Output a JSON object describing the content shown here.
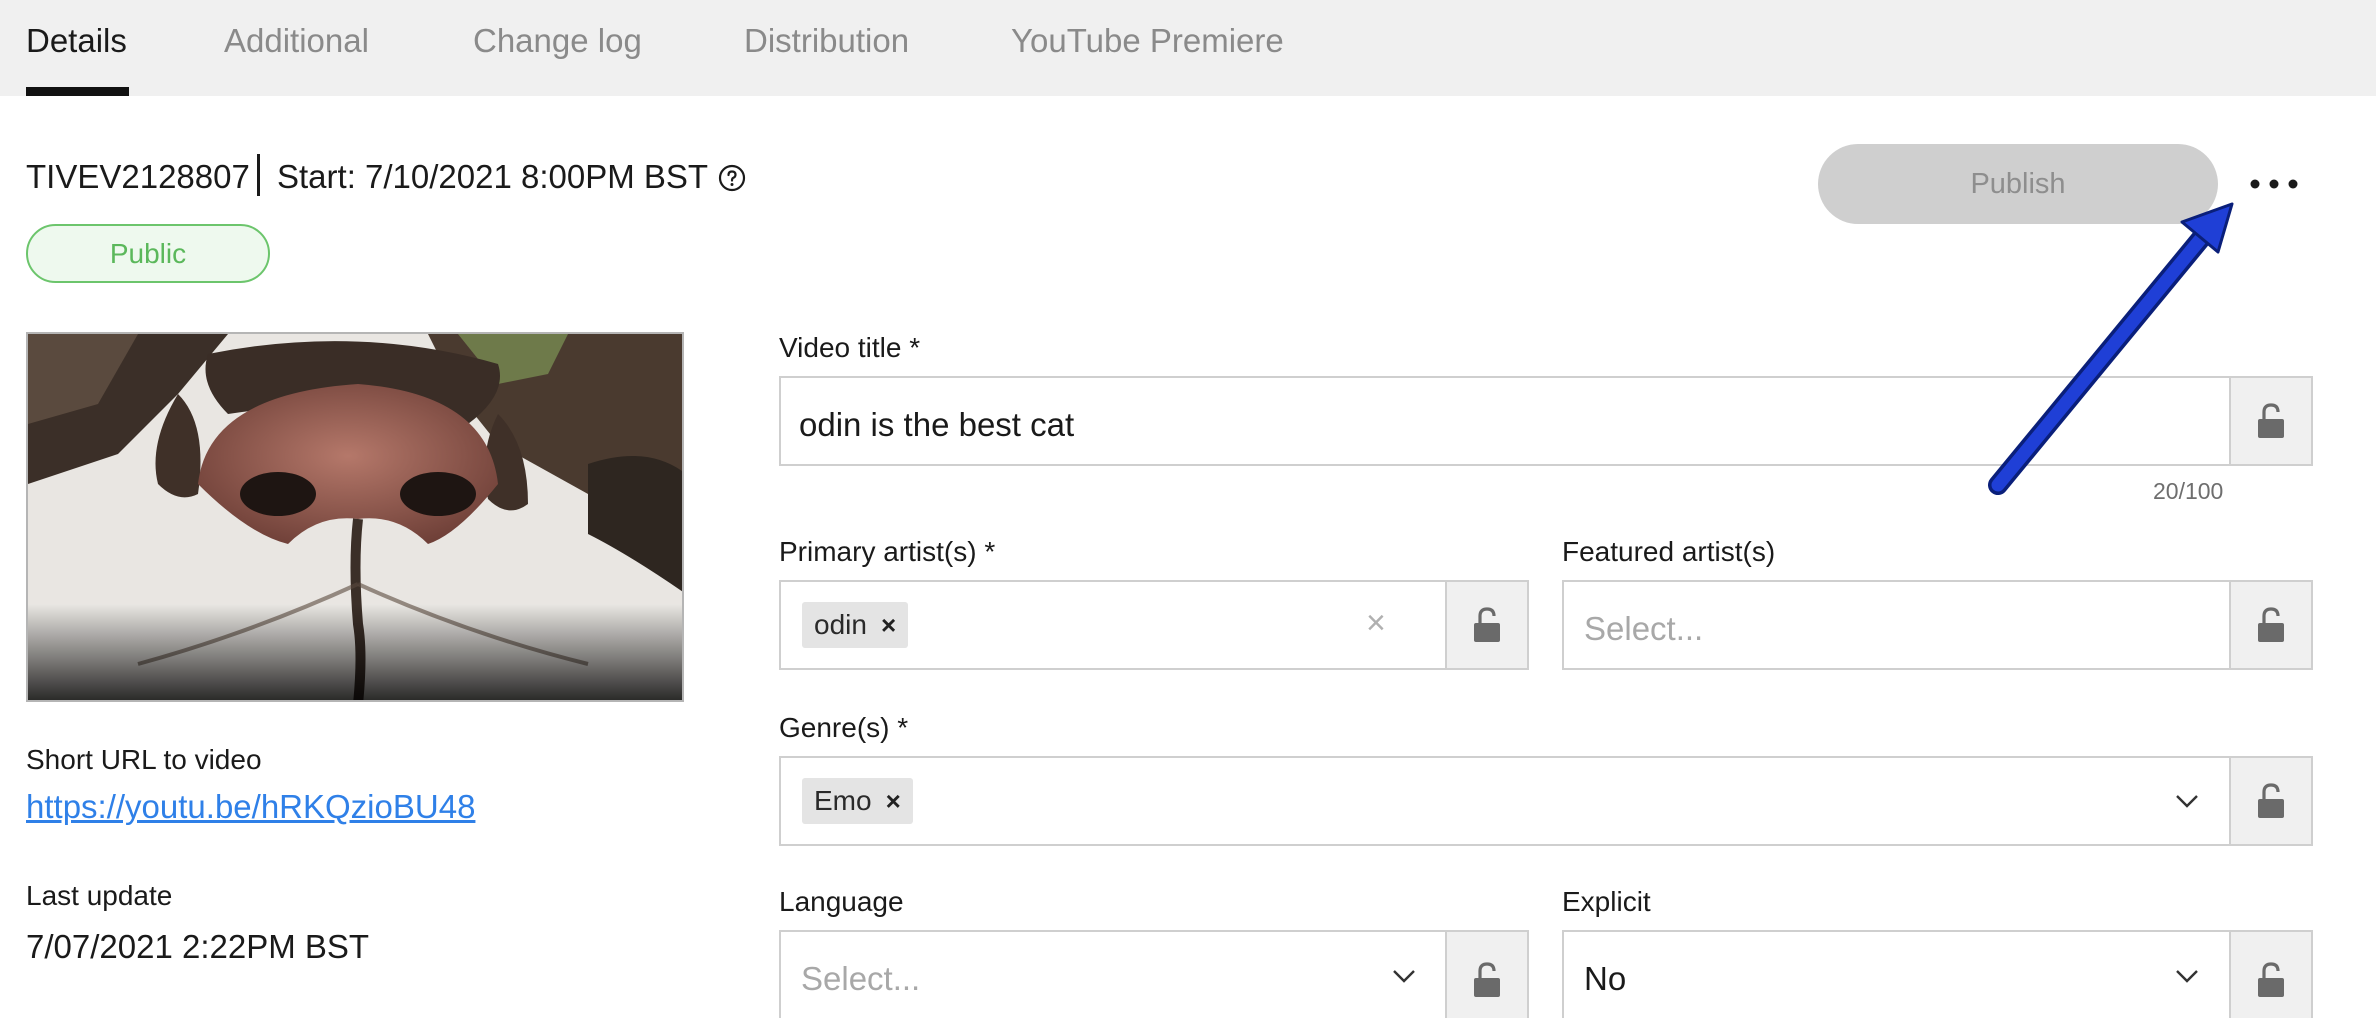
{
  "tabs": [
    {
      "label": "Details",
      "active": true
    },
    {
      "label": "Additional",
      "active": false
    },
    {
      "label": "Change log",
      "active": false
    },
    {
      "label": "Distribution",
      "active": false
    },
    {
      "label": "YouTube Premiere",
      "active": false
    }
  ],
  "header": {
    "asset_id": "TIVEV2128807",
    "start": "Start: 7/10/2021 8:00PM BST",
    "help_icon": "question-circle-icon",
    "status_badge": "Public",
    "publish_label": "Publish",
    "more_icon": "more-horizontal-icon"
  },
  "left": {
    "thumbnail_icon": "video-thumbnail-cat-nose",
    "short_url_label": "Short URL to video",
    "short_url": "https://youtu.be/hRKQzioBU48",
    "last_update_label": "Last update",
    "last_update_value": "7/07/2021 2:22PM BST"
  },
  "form": {
    "video_title": {
      "label": "Video title *",
      "value": "odin is the best cat",
      "counter": "20/100"
    },
    "primary_artists": {
      "label": "Primary artist(s) *",
      "chips": [
        "odin"
      ]
    },
    "featured_artists": {
      "label": "Featured artist(s)",
      "placeholder": "Select..."
    },
    "genres": {
      "label": "Genre(s) *",
      "chips": [
        "Emo"
      ]
    },
    "language": {
      "label": "Language",
      "placeholder": "Select..."
    },
    "explicit": {
      "label": "Explicit",
      "value": "No"
    }
  },
  "colors": {
    "accent_link": "#2f80e8",
    "public_green": "#5bb85b",
    "annotation_arrow": "#1f3fd6"
  }
}
